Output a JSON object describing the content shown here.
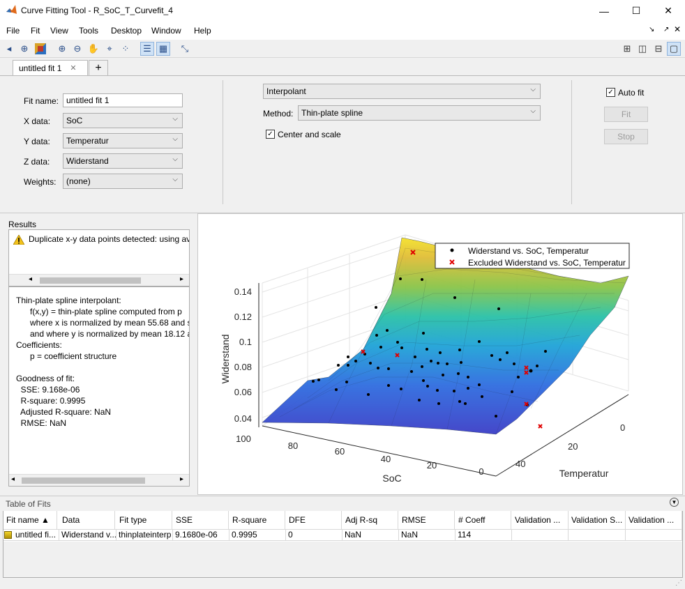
{
  "window": {
    "title": "Curve Fitting Tool - R_SoC_T_Curvefit_4",
    "minimize": "—",
    "maximize": "☐",
    "close": "✕"
  },
  "menu": [
    "File",
    "Fit",
    "View",
    "Tools",
    "Desktop",
    "Window",
    "Help"
  ],
  "toolbar": {
    "icons": [
      "pan-left-icon",
      "data-cursor-icon",
      "colormap-icon",
      "zoom-in-icon",
      "zoom-out-icon",
      "pan-hand-icon",
      "data-tip-icon",
      "exclude-points-icon",
      "legend-icon",
      "grid-icon",
      "residuals-icon"
    ],
    "layouts": [
      "layout-grid-icon",
      "layout-columns-icon",
      "layout-rows-icon",
      "layout-single-icon"
    ]
  },
  "tabs": {
    "active": "untitled fit 1",
    "close": "✕",
    "add": "+"
  },
  "fit_panel": {
    "fit_name_label": "Fit name:",
    "fit_name_value": "untitled fit 1",
    "x_label": "X data:",
    "x_value": "SoC",
    "y_label": "Y data:",
    "y_value": "Temperatur",
    "z_label": "Z data:",
    "z_value": "Widerstand",
    "w_label": "Weights:",
    "w_value": "(none)",
    "fit_type": "Interpolant",
    "method_label": "Method:",
    "method_value": "Thin-plate spline",
    "center_scale_label": "Center and scale",
    "auto_fit_label": "Auto fit",
    "fit_button": "Fit",
    "stop_button": "Stop"
  },
  "results": {
    "title": "Results",
    "warning": "Duplicate x-y data points detected: using av",
    "lines": [
      "Thin-plate spline interpolant:",
      "      f(x,y) = thin-plate spline computed from p",
      "      where x is normalized by mean 55.68 and st",
      "      and where y is normalized by mean 18.12 ar",
      "Coefficients:",
      "      p = coefficient structure",
      "",
      "Goodness of fit:",
      "  SSE: 9.168e-06",
      "  R-square: 0.9995",
      "  Adjusted R-square: NaN",
      "  RMSE: NaN"
    ]
  },
  "plot": {
    "zlabel": "Widerstand",
    "xlabel": "SoC",
    "ylabel": "Temperatur",
    "z_ticks": [
      "0.14",
      "0.12",
      "0.1",
      "0.08",
      "0.06",
      "0.04"
    ],
    "x_ticks": [
      "100",
      "80",
      "60",
      "40",
      "20",
      "0"
    ],
    "y_ticks": [
      "0",
      "20",
      "40"
    ],
    "legend": [
      "Widerstand vs. SoC, Temperatur",
      "Excluded Widerstand vs. SoC, Temperatur"
    ]
  },
  "table": {
    "title": "Table of Fits",
    "headers": [
      "Fit name ▲",
      "Data",
      "Fit type",
      "SSE",
      "R-square",
      "DFE",
      "Adj R-sq",
      "RMSE",
      "# Coeff",
      "Validation ...",
      "Validation S...",
      "Validation ..."
    ],
    "row": [
      "untitled fi...",
      "Widerstand v...",
      "thinplateinterp",
      "9.1680e-06",
      "0.9995",
      "0",
      "NaN",
      "NaN",
      "114",
      "",
      "",
      ""
    ]
  },
  "colors": {
    "accent": "#1f6fb2",
    "excluded": "#e00000"
  }
}
